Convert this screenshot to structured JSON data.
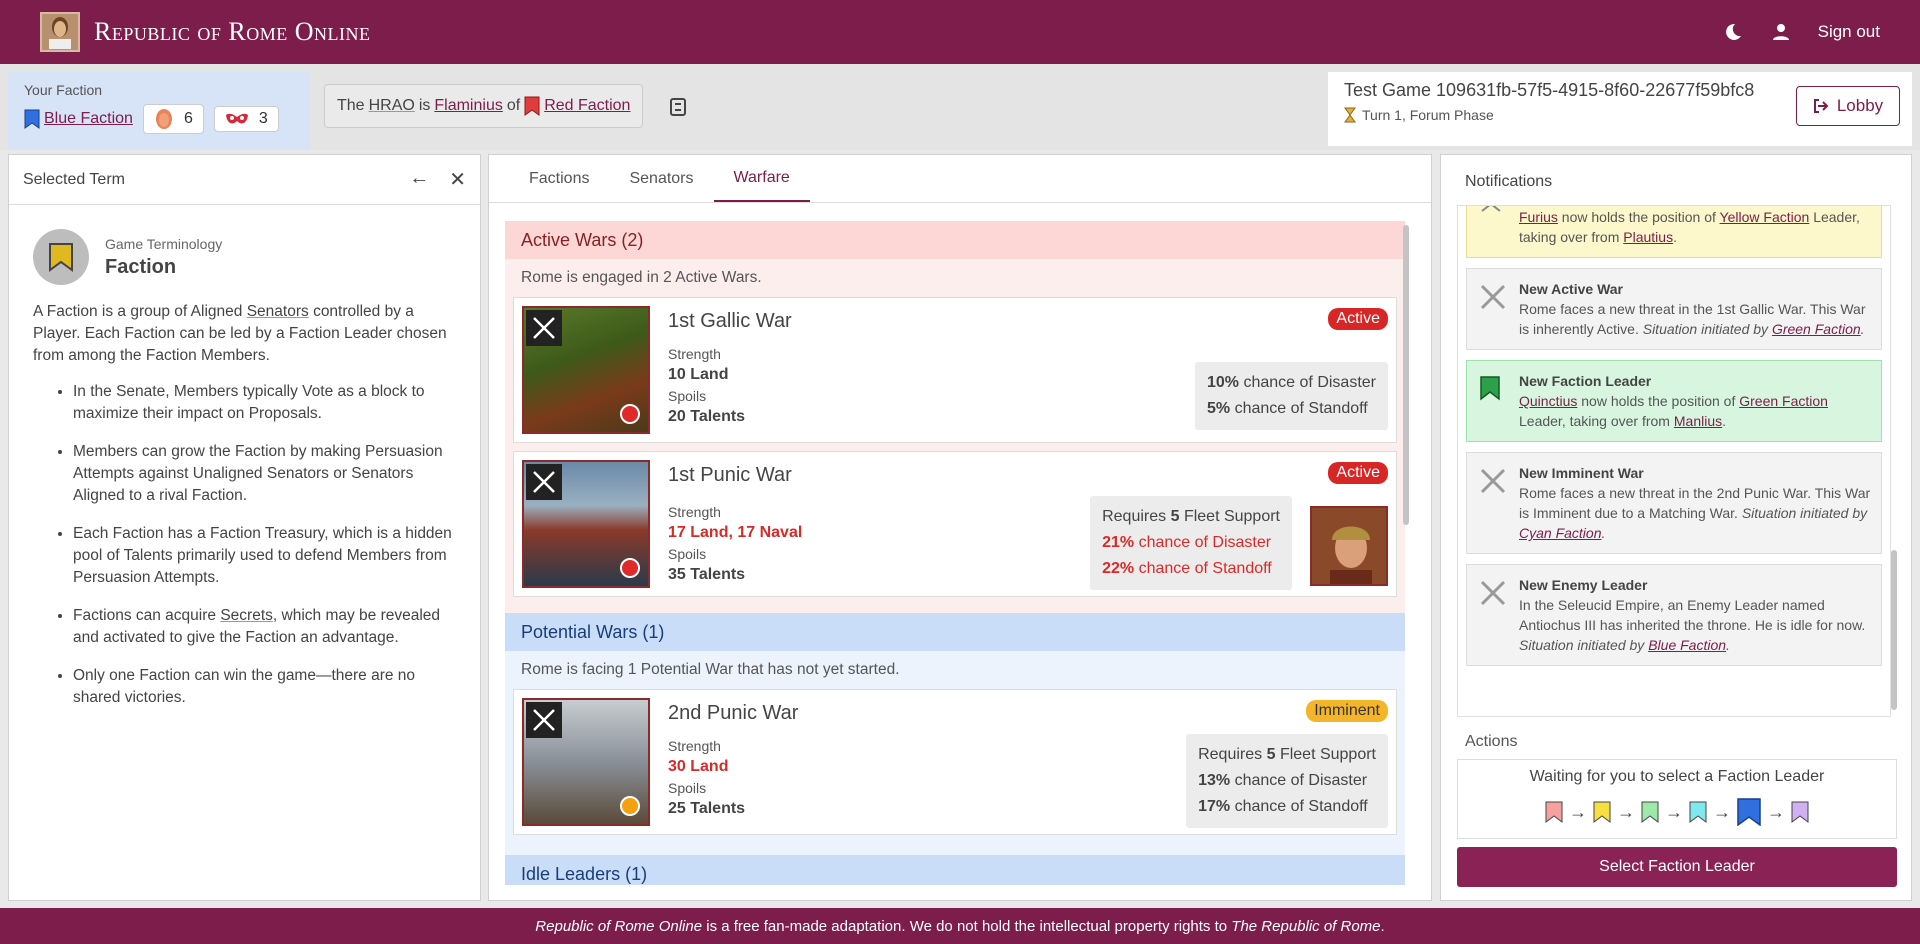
{
  "header": {
    "app_title": "Republic of Rome Online",
    "sign_out": "Sign out"
  },
  "your_faction": {
    "label": "Your Faction",
    "name": "Blue Faction",
    "influence": "6",
    "secrets": "3"
  },
  "hrao": {
    "prefix": "The",
    "hrao": "HRAO",
    "is": "is",
    "senator": "Flaminius",
    "of": "of",
    "faction": "Red Faction"
  },
  "game": {
    "title": "Test Game 109631fb-57f5-4915-8f60-22677f59bfc8",
    "turn": "Turn 1, Forum Phase",
    "lobby": "Lobby"
  },
  "left": {
    "title": "Selected Term",
    "category": "Game Terminology",
    "term": "Faction",
    "desc_a": "A Faction is a group of Aligned",
    "desc_link": "Senators",
    "desc_b": "controlled by a Player. Each Faction can be led by a Faction Leader chosen from among the Faction Members.",
    "bullets": [
      "In the Senate, Members typically Vote as a block to maximize their impact on Proposals.",
      "Members can grow the Faction by making Persuasion Attempts against Unaligned Senators or Senators Aligned to a rival Faction.",
      "Each Faction has a Faction Treasury, which is a hidden pool of Talents primarily used to defend Members from Persuasion Attempts.",
      "Only one Faction can win the game—there are no shared victories."
    ],
    "bullet4_a": "Factions can acquire",
    "bullet4_link": "Secrets",
    "bullet4_b": ", which may be revealed and activated to give the Faction an advantage."
  },
  "tabs": [
    "Factions",
    "Senators",
    "Warfare"
  ],
  "wars": {
    "active_title": "Active Wars (2)",
    "active_text": "Rome is engaged in 2 Active Wars.",
    "potential_title": "Potential Wars (1)",
    "potential_text": "Rome is facing 1 Potential War that has not yet started.",
    "next_title": "Idle Leaders (1)",
    "strength_label": "Strength",
    "spoils_label": "Spoils",
    "list": [
      {
        "name": "1st Gallic War",
        "status": "Active",
        "strength": "10 Land",
        "spoils": "20 Talents",
        "disaster": "10%",
        "standoff": "5%",
        "fleet": ""
      },
      {
        "name": "1st Punic War",
        "status": "Active",
        "strength_land": "17 Land",
        "strength_naval": "17 Naval",
        "spoils": "35 Talents",
        "disaster": "21%",
        "standoff": "22%",
        "fleet": "5"
      },
      {
        "name": "2nd Punic War",
        "status": "Imminent",
        "strength": "30 Land",
        "spoils": "25 Talents",
        "disaster": "13%",
        "standoff": "17%",
        "fleet": "5"
      }
    ],
    "requires": "Requires",
    "fleet_support": "Fleet Support",
    "chance_disaster": "chance of Disaster",
    "chance_standoff": "chance of Standoff"
  },
  "notifications": {
    "title": "Notifications",
    "items": [
      {
        "type": "yellow",
        "title": "",
        "text_a": "",
        "link1": "Furius",
        "text_b": " now holds the position of ",
        "link2": "Yellow Faction",
        "text_c": " Leader, taking over from ",
        "link3": "Plautius",
        "text_d": "."
      },
      {
        "type": "war",
        "title": "New Active War",
        "text": "Rome faces a new threat in the 1st Gallic War. This War is inherently Active.",
        "situation": "Situation initiated by",
        "faction": "Green Faction"
      },
      {
        "type": "green",
        "title": "New Faction Leader",
        "link1": "Quinctius",
        "text_b": " now holds the position of ",
        "link2": "Green Faction",
        "text_c": " Leader, taking over from ",
        "link3": "Manlius",
        "text_d": "."
      },
      {
        "type": "war",
        "title": "New Imminent War",
        "text": "Rome faces a new threat in the 2nd Punic War. This War is Imminent due to a Matching War.",
        "situation": "Situation initiated by",
        "faction": "Cyan Faction"
      },
      {
        "type": "war",
        "title": "New Enemy Leader",
        "text": "In the Seleucid Empire, an Enemy Leader named Antiochus III has inherited the throne. He is idle for now.",
        "situation": "Situation initiated by",
        "faction": "Blue Faction"
      }
    ]
  },
  "actions": {
    "title": "Actions",
    "message": "Waiting for you to select a Faction Leader",
    "button": "Select Faction Leader"
  },
  "footer": {
    "a": "Republic of Rome Online",
    "b": " is a free fan-made adaptation. We do not hold the intellectual property rights to ",
    "c": "The Republic of Rome",
    "d": "."
  },
  "colors": {
    "brand": "#7c1d4b",
    "active": "#d82626",
    "imminent": "#f4b52a"
  }
}
